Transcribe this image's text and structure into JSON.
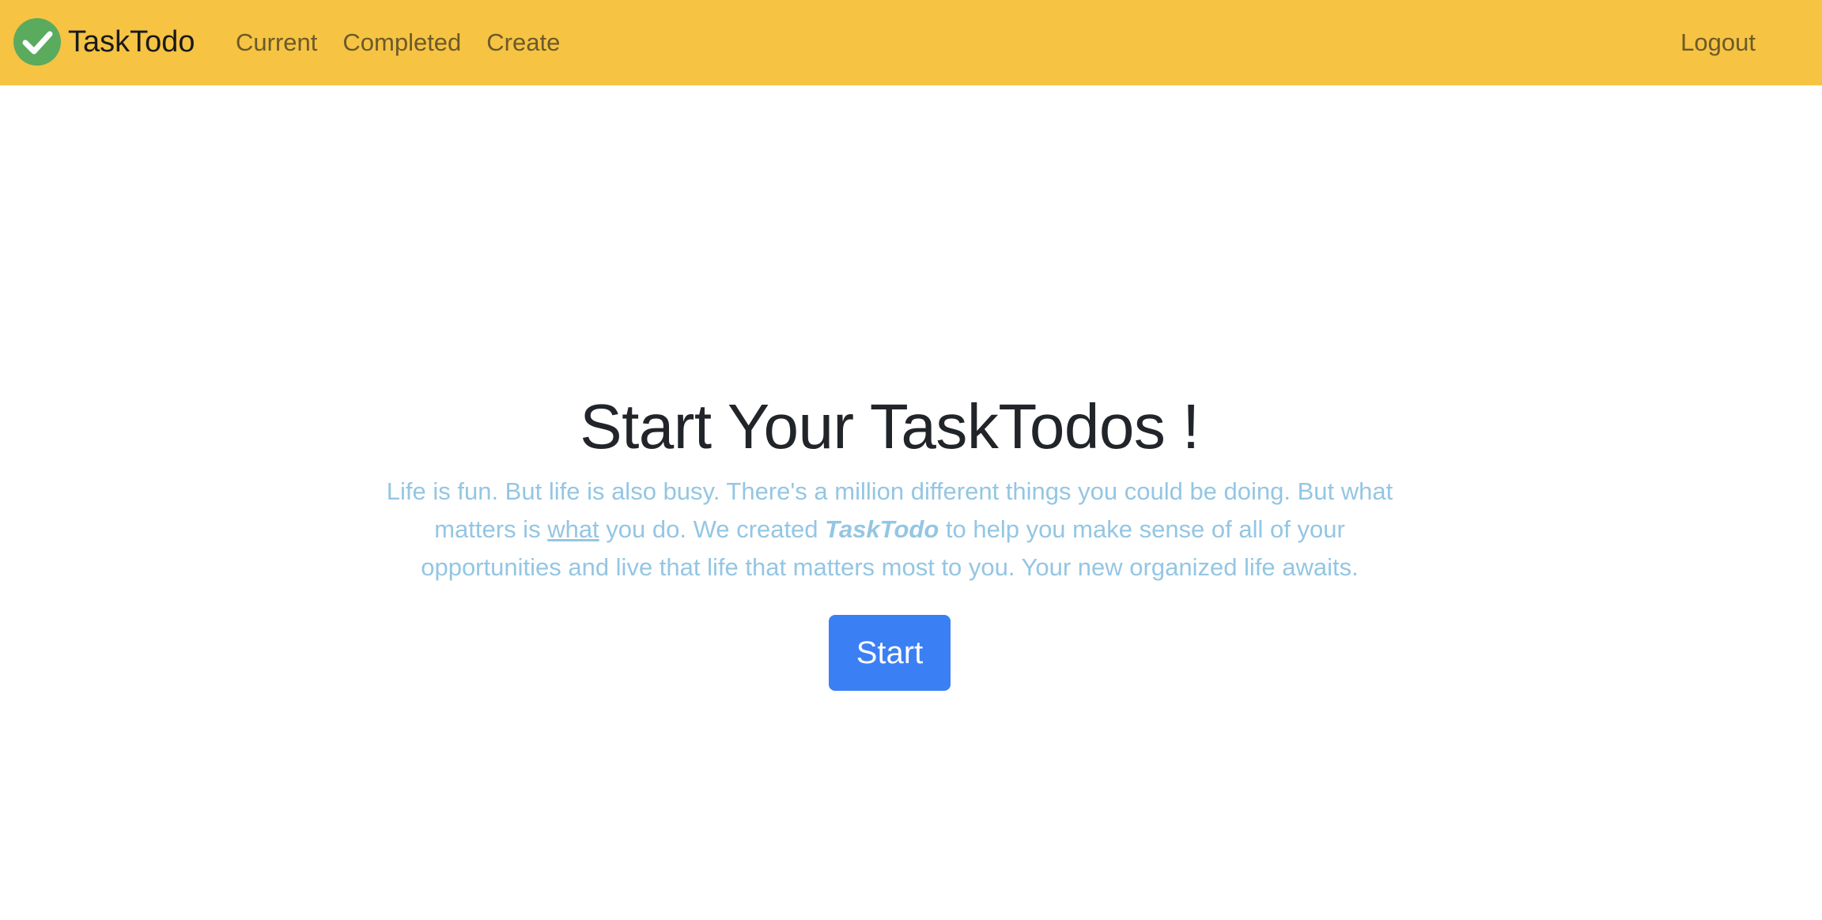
{
  "navbar": {
    "brand_name": "TaskTodo",
    "logo_icon": "check-circle-icon",
    "links": [
      {
        "label": "Current"
      },
      {
        "label": "Completed"
      },
      {
        "label": "Create"
      }
    ],
    "logout_label": "Logout",
    "background_color": "#f6c343"
  },
  "hero": {
    "title": "Start Your TaskTodos !",
    "lead_part1": "Life is fun. But life is also busy. There's a million different things you could be doing. But what matters is ",
    "lead_underlined": "what",
    "lead_part2": " you do. We created ",
    "lead_brand": "TaskTodo",
    "lead_part3": " to help you make sense of all of your opportunities and live that life that matters most to you. Your new organized life awaits.",
    "button_label": "Start",
    "button_color": "#3b7ff5",
    "lead_color": "#94c6e3"
  }
}
